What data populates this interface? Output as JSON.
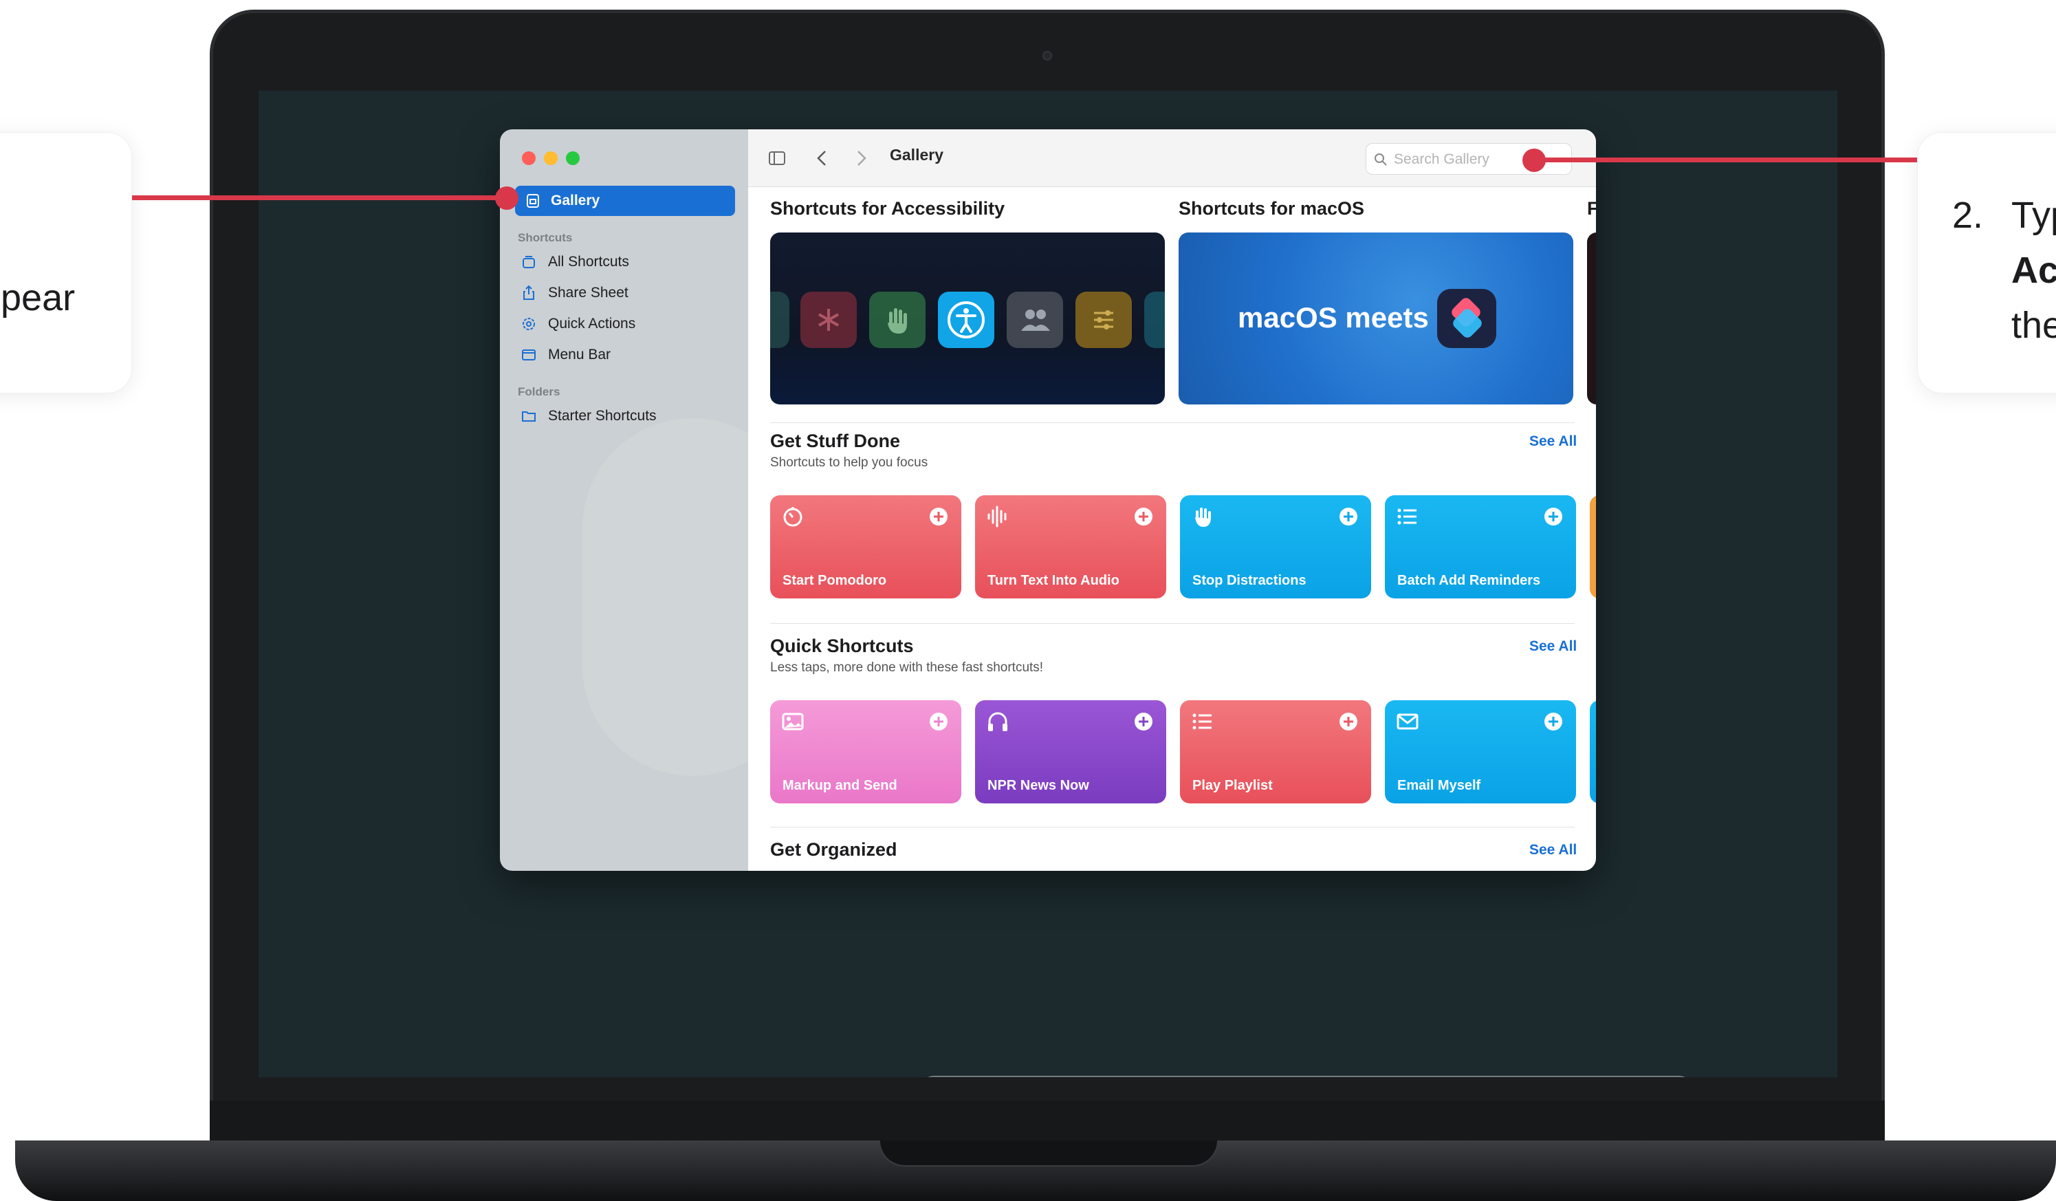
{
  "callouts": {
    "left": {
      "text": "pear"
    },
    "right": {
      "number": "2.",
      "line1": "Typ",
      "line2": "Ac",
      "line3": "the"
    }
  },
  "window": {
    "title": "Gallery",
    "search_placeholder": "Search Gallery"
  },
  "sidebar": {
    "selected": "Gallery",
    "shortcuts_heading": "Shortcuts",
    "items": [
      "All Shortcuts",
      "Share Sheet",
      "Quick Actions",
      "Menu Bar"
    ],
    "folders_heading": "Folders",
    "folders": [
      "Starter Shortcuts"
    ]
  },
  "banners": [
    {
      "title": "Shortcuts for Accessibility"
    },
    {
      "title": "Shortcuts for macOS",
      "text": "macOS meets"
    },
    {
      "title": "F"
    }
  ],
  "sections": [
    {
      "title": "Get Stuff Done",
      "subtitle": "Shortcuts to help you focus",
      "see_all": "See All",
      "cards": [
        {
          "label": "Start Pomodoro",
          "icon": "timer-icon",
          "color": "#ea5a62"
        },
        {
          "label": "Turn Text Into Audio",
          "icon": "waveform-icon",
          "color": "#ea5a62"
        },
        {
          "label": "Stop Distractions",
          "icon": "hand-icon",
          "color": "#0aa8ea"
        },
        {
          "label": "Batch Add Reminders",
          "icon": "list-icon",
          "color": "#0aa8ea"
        }
      ]
    },
    {
      "title": "Quick Shortcuts",
      "subtitle": "Less taps, more done with these fast shortcuts!",
      "see_all": "See All",
      "cards": [
        {
          "label": "Markup and Send",
          "icon": "photo-icon",
          "color": "#ee83cf"
        },
        {
          "label": "NPR News Now",
          "icon": "headphones-icon",
          "color": "#8444c6"
        },
        {
          "label": "Play Playlist",
          "icon": "list-icon",
          "color": "#ea5a62"
        },
        {
          "label": "Email Myself",
          "icon": "envelope-icon",
          "color": "#0aa8ea"
        }
      ]
    },
    {
      "title": "Get Organized",
      "see_all": "See All"
    }
  ],
  "dock": {
    "apps": [
      "finder-icon",
      "safari-icon",
      "notes-icon",
      "app-store-icon",
      "photos-icon",
      "shortcuts-icon",
      "quicktime-icon",
      "textedit-icon",
      "downloads-folder-icon",
      "trash-icon"
    ]
  },
  "colors": {
    "accent": "#1a6fd4",
    "callout_line": "#d9384a"
  }
}
